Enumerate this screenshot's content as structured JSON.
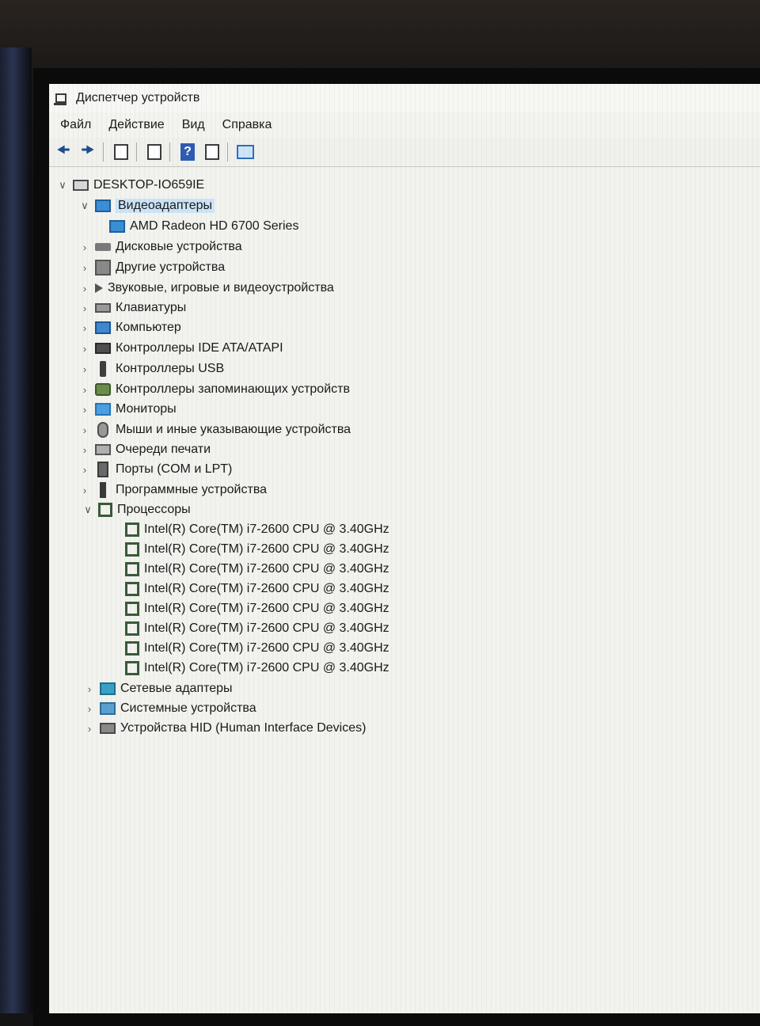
{
  "window": {
    "title": "Диспетчер устройств"
  },
  "menu": {
    "items": [
      "Файл",
      "Действие",
      "Вид",
      "Справка"
    ]
  },
  "toolbar": {
    "buttons": [
      "back-arrow-icon",
      "forward-arrow-icon",
      "console-tree-icon",
      "properties-icon",
      "help-icon",
      "action-pane-icon",
      "scan-hardware-icon"
    ]
  },
  "tree": {
    "root": "DESKTOP-IO659IE",
    "categories": [
      {
        "label": "Видеоадаптеры",
        "expanded": true,
        "selected": true,
        "icon": "display-adapter-icon",
        "children": [
          "AMD Radeon HD 6700 Series"
        ]
      },
      {
        "label": "Дисковые устройства",
        "expanded": false,
        "icon": "disk-drive-icon"
      },
      {
        "label": "Другие устройства",
        "expanded": false,
        "icon": "unknown-device-icon"
      },
      {
        "label": "Звуковые, игровые и видеоустройства",
        "expanded": false,
        "icon": "speaker-icon"
      },
      {
        "label": "Клавиатуры",
        "expanded": false,
        "icon": "keyboard-icon"
      },
      {
        "label": "Компьютер",
        "expanded": false,
        "icon": "computer-icon"
      },
      {
        "label": "Контроллеры IDE ATA/ATAPI",
        "expanded": false,
        "icon": "ide-controller-icon"
      },
      {
        "label": "Контроллеры USB",
        "expanded": false,
        "icon": "usb-icon"
      },
      {
        "label": "Контроллеры запоминающих устройств",
        "expanded": false,
        "icon": "storage-controller-icon"
      },
      {
        "label": "Мониторы",
        "expanded": false,
        "icon": "monitor-icon"
      },
      {
        "label": "Мыши и иные указывающие устройства",
        "expanded": false,
        "icon": "mouse-icon"
      },
      {
        "label": "Очереди печати",
        "expanded": false,
        "icon": "printer-icon"
      },
      {
        "label": "Порты (COM и LPT)",
        "expanded": false,
        "icon": "port-icon"
      },
      {
        "label": "Программные устройства",
        "expanded": false,
        "icon": "software-device-icon"
      },
      {
        "label": "Процессоры",
        "expanded": true,
        "icon": "processor-icon",
        "children": [
          "Intel(R) Core(TM) i7-2600 CPU @ 3.40GHz",
          "Intel(R) Core(TM) i7-2600 CPU @ 3.40GHz",
          "Intel(R) Core(TM) i7-2600 CPU @ 3.40GHz",
          "Intel(R) Core(TM) i7-2600 CPU @ 3.40GHz",
          "Intel(R) Core(TM) i7-2600 CPU @ 3.40GHz",
          "Intel(R) Core(TM) i7-2600 CPU @ 3.40GHz",
          "Intel(R) Core(TM) i7-2600 CPU @ 3.40GHz",
          "Intel(R) Core(TM) i7-2600 CPU @ 3.40GHz"
        ]
      },
      {
        "label": "Сетевые адаптеры",
        "expanded": false,
        "icon": "network-adapter-icon"
      },
      {
        "label": "Системные устройства",
        "expanded": false,
        "icon": "system-device-icon"
      },
      {
        "label": "Устройства HID (Human Interface Devices)",
        "expanded": false,
        "icon": "hid-icon"
      }
    ]
  }
}
